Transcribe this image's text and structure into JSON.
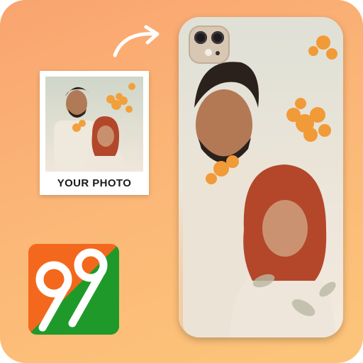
{
  "card": {
    "caption": "YOUR PHOTO"
  },
  "colors": {
    "background_top": "#f9a46f",
    "background_bottom": "#fcc57a",
    "logo_orange": "#f3681c",
    "logo_green": "#1f9a2a",
    "caption_text": "#1b1b1b"
  },
  "icons": {
    "arrow": "curved-arrow-right-icon",
    "logo": "app-logo-99-icon"
  }
}
